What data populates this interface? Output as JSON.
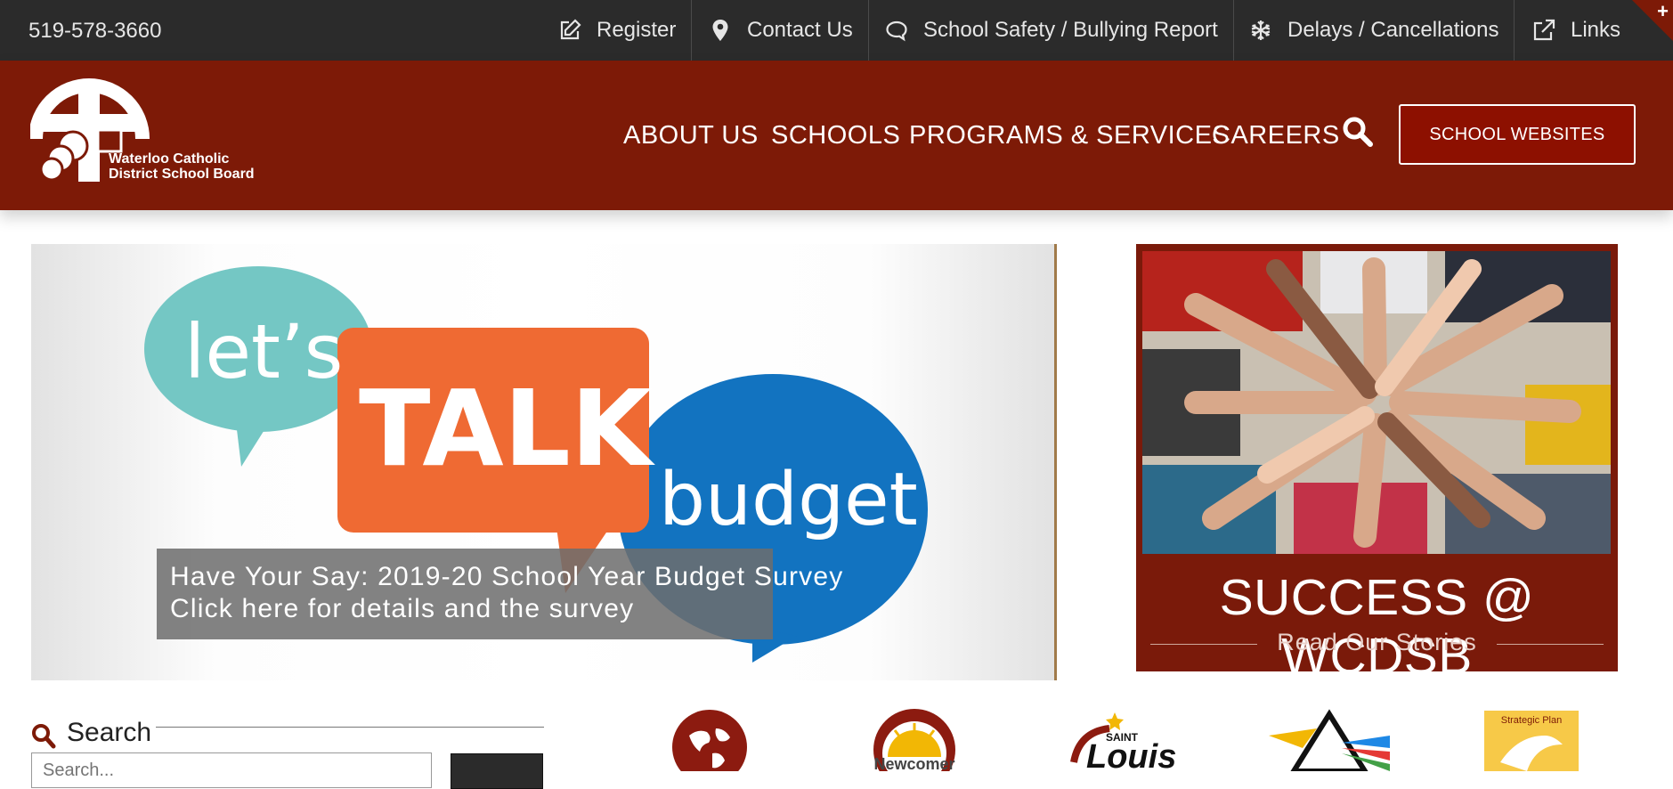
{
  "topbar": {
    "phone": "519-578-3660",
    "links": [
      {
        "label": "Register",
        "icon": "edit-icon"
      },
      {
        "label": "Contact Us",
        "icon": "map-pin-icon"
      },
      {
        "label": "School Safety / Bullying Report",
        "icon": "chat-bubble-icon"
      },
      {
        "label": "Delays / Cancellations",
        "icon": "snowflake-icon"
      },
      {
        "label": "Links",
        "icon": "external-link-icon"
      }
    ],
    "corner_plus": "+"
  },
  "header": {
    "logo_line1": "Waterloo Catholic",
    "logo_line2": "District School Board",
    "nav": [
      "ABOUT US",
      "SCHOOLS",
      "PROGRAMS & SERVICES",
      "CAREERS"
    ],
    "school_websites_label": "SCHOOL WEBSITES"
  },
  "slider": {
    "art_lets": "let’s",
    "art_talk": "TALK",
    "art_budget": "budget",
    "caption_line1": "Have Your Say: 2019-20 School Year Budget Survey",
    "caption_line2": "Click here for details and the survey"
  },
  "promo": {
    "title": "SUCCESS @ WCDSB",
    "subtitle": "Read Our Stories"
  },
  "search": {
    "label": "Search",
    "placeholder": "Search..."
  },
  "quick_links": {
    "newcomer_label": "Newcomer",
    "saint_label": "SAINT",
    "louis_label": "Louis",
    "strategic_label": "Strategic Plan"
  },
  "colors": {
    "topbar": "#2b2b2b",
    "brand_maroon": "#7d1a07",
    "promo_maroon": "#7a1a0a",
    "talk_orange": "#ef6a33",
    "lets_teal": "#74c7c4",
    "budget_blue": "#1273c0"
  }
}
